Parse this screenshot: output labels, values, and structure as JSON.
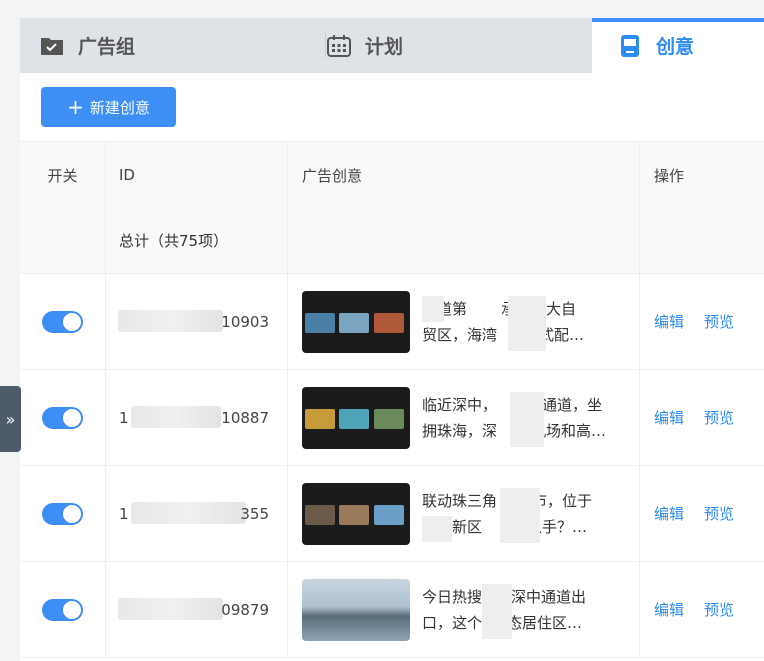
{
  "tabs": {
    "ad_group": "广告组",
    "plan": "计划",
    "creative": "创意"
  },
  "toolbar": {
    "new_creative": "新建创意"
  },
  "table": {
    "headers": {
      "switch": "开关",
      "id": "ID",
      "creative": "广告创意",
      "action": "操作"
    },
    "summary": "总计（共75项）",
    "rows": [
      {
        "id_suffix": "10903",
        "line1": "通道第",
        "line1b": "承接三大自",
        "line2": "贸区，海湾",
        "line2b": "一站式配…",
        "edit": "编辑",
        "preview": "预览"
      },
      {
        "id_prefix": "1",
        "id_suffix": "10887",
        "line1": "临近深中，",
        "line1b": "双通道，坐",
        "line2": "拥珠海，深",
        "line2b": "机场和高…",
        "edit": "编辑",
        "preview": "预览"
      },
      {
        "id_prefix": "1",
        "id_suffix": "355",
        "line1": "联动珠三角",
        "line1b": "城市，位于",
        "line2": "新区",
        "line2b": "得入手？…",
        "edit": "编辑",
        "preview": "预览"
      },
      {
        "id_suffix": "09879",
        "line1": "今日热搜",
        "line1b": "于深中通道出",
        "line2": "口，这个",
        "line2b": "生态居住区…",
        "edit": "编辑",
        "preview": "预览"
      }
    ]
  },
  "side_handle": "»",
  "colors": {
    "accent": "#3e8ff5",
    "tab_bg": "#dfe3e8"
  }
}
